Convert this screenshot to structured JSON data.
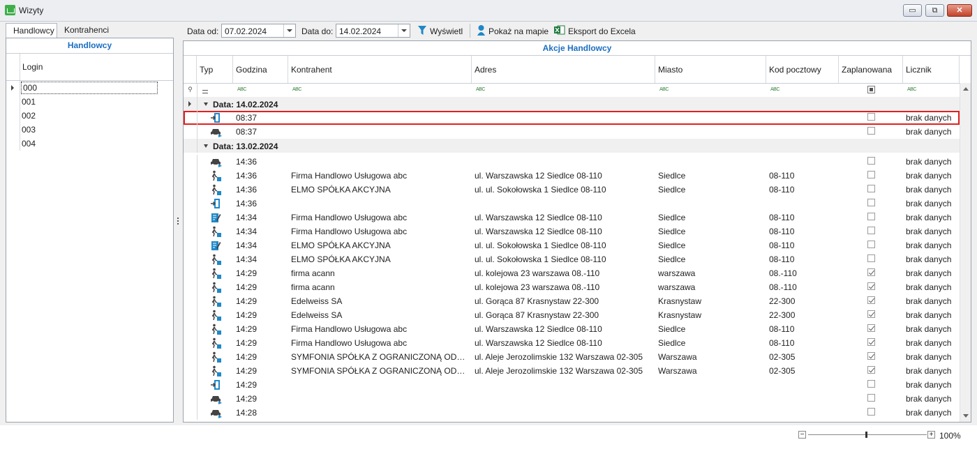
{
  "window": {
    "title": "Wizyty",
    "min_label": "▭",
    "restore_label": "⧉",
    "close_label": "✕"
  },
  "left_tabs": [
    {
      "label": "Handlowcy"
    },
    {
      "label": "Kontrahenci"
    }
  ],
  "left_panel": {
    "title": "Handlowcy",
    "column": "Login",
    "items": [
      "000",
      "001",
      "002",
      "003",
      "004"
    ],
    "selected_index": 0
  },
  "toolbar": {
    "date_from_label": "Data od:",
    "date_from": "07.02.2024",
    "date_to_label": "Data do:",
    "date_to": "14.02.2024",
    "show_label": "Wyświetl",
    "map_label": "Pokaż na mapie",
    "excel_label": "Eksport do Excela"
  },
  "grid": {
    "title": "Akcje Handlowcy",
    "columns": [
      "Typ",
      "Godzina",
      "Kontrahent",
      "Adres",
      "Miasto",
      "Kod pocztowy",
      "Zaplanowana",
      "Licznik"
    ],
    "groups": [
      {
        "label": "Data: 14.02.2024",
        "rows": [
          {
            "icon": "door-exit-icon",
            "time": "08:37",
            "client": "",
            "address": "",
            "city": "",
            "zip": "",
            "planned": false,
            "counter": "brak danych",
            "selected": true
          },
          {
            "icon": "car-icon",
            "time": "08:37",
            "client": "",
            "address": "",
            "city": "",
            "zip": "",
            "planned": false,
            "counter": "brak danych"
          }
        ]
      },
      {
        "label": "Data: 13.02.2024",
        "rows": [
          {
            "icon": "car-icon",
            "time": "14:36",
            "client": "",
            "address": "",
            "city": "",
            "zip": "",
            "planned": false,
            "counter": "brak danych"
          },
          {
            "icon": "walk-icon",
            "time": "14:36",
            "client": "Firma Handlowo Usługowa abc",
            "address": "ul. Warszawska 12 Siedlce 08-110",
            "city": "Siedlce",
            "zip": "08-110",
            "planned": false,
            "counter": "brak danych"
          },
          {
            "icon": "walk-icon",
            "time": "14:36",
            "client": "ELMO SPÓŁKA AKCYJNA",
            "address": "ul. ul. Sokołowska 1 Siedlce 08-110",
            "city": "Siedlce",
            "zip": "08-110",
            "planned": false,
            "counter": "brak danych"
          },
          {
            "icon": "door-exit-icon",
            "time": "14:36",
            "client": "",
            "address": "",
            "city": "",
            "zip": "",
            "planned": false,
            "counter": "brak danych"
          },
          {
            "icon": "note-edit-icon",
            "time": "14:34",
            "client": "Firma Handlowo Usługowa abc",
            "address": "ul. Warszawska 12 Siedlce 08-110",
            "city": "Siedlce",
            "zip": "08-110",
            "planned": false,
            "counter": "brak danych"
          },
          {
            "icon": "walk-icon",
            "time": "14:34",
            "client": "Firma Handlowo Usługowa abc",
            "address": "ul. Warszawska 12 Siedlce 08-110",
            "city": "Siedlce",
            "zip": "08-110",
            "planned": false,
            "counter": "brak danych"
          },
          {
            "icon": "note-edit-icon",
            "time": "14:34",
            "client": "ELMO SPÓŁKA AKCYJNA",
            "address": "ul. ul. Sokołowska 1 Siedlce 08-110",
            "city": "Siedlce",
            "zip": "08-110",
            "planned": false,
            "counter": "brak danych"
          },
          {
            "icon": "walk-icon",
            "time": "14:34",
            "client": "ELMO SPÓŁKA AKCYJNA",
            "address": "ul. ul. Sokołowska 1 Siedlce 08-110",
            "city": "Siedlce",
            "zip": "08-110",
            "planned": false,
            "counter": "brak danych"
          },
          {
            "icon": "walk-icon",
            "time": "14:29",
            "client": "firma acann",
            "address": "ul. kolejowa 23 warszawa 08.-110",
            "city": "warszawa",
            "zip": "08.-110",
            "planned": true,
            "counter": "brak danych"
          },
          {
            "icon": "walk-icon",
            "time": "14:29",
            "client": "firma acann",
            "address": "ul. kolejowa 23 warszawa 08.-110",
            "city": "warszawa",
            "zip": "08.-110",
            "planned": true,
            "counter": "brak danych"
          },
          {
            "icon": "walk-icon",
            "time": "14:29",
            "client": "Edelweiss SA",
            "address": "ul. Gorąca 87 Krasnystaw 22-300",
            "city": "Krasnystaw",
            "zip": "22-300",
            "planned": true,
            "counter": "brak danych"
          },
          {
            "icon": "walk-icon",
            "time": "14:29",
            "client": "Edelweiss SA",
            "address": "ul. Gorąca 87 Krasnystaw 22-300",
            "city": "Krasnystaw",
            "zip": "22-300",
            "planned": true,
            "counter": "brak danych"
          },
          {
            "icon": "walk-icon",
            "time": "14:29",
            "client": "Firma Handlowo Usługowa abc",
            "address": "ul. Warszawska 12 Siedlce 08-110",
            "city": "Siedlce",
            "zip": "08-110",
            "planned": true,
            "counter": "brak danych"
          },
          {
            "icon": "walk-icon",
            "time": "14:29",
            "client": "Firma Handlowo Usługowa abc",
            "address": "ul. Warszawska 12 Siedlce 08-110",
            "city": "Siedlce",
            "zip": "08-110",
            "planned": true,
            "counter": "brak danych"
          },
          {
            "icon": "walk-icon",
            "time": "14:29",
            "client": "SYMFONIA SPÓŁKA Z OGRANICZONĄ ODPOWIEDZIALNOŚCIĄ",
            "address": "ul. Aleje Jerozolimskie 132 Warszawa 02-305",
            "city": "Warszawa",
            "zip": "02-305",
            "planned": true,
            "counter": "brak danych"
          },
          {
            "icon": "walk-icon",
            "time": "14:29",
            "client": "SYMFONIA SPÓŁKA Z OGRANICZONĄ ODPOWIEDZIALNOŚCIĄ",
            "address": "ul. Aleje Jerozolimskie 132 Warszawa 02-305",
            "city": "Warszawa",
            "zip": "02-305",
            "planned": true,
            "counter": "brak danych"
          },
          {
            "icon": "door-exit-icon",
            "time": "14:29",
            "client": "",
            "address": "",
            "city": "",
            "zip": "",
            "planned": false,
            "counter": "brak danych"
          },
          {
            "icon": "car-icon",
            "time": "14:29",
            "client": "",
            "address": "",
            "city": "",
            "zip": "",
            "planned": false,
            "counter": "brak danych"
          },
          {
            "icon": "car-icon",
            "time": "14:28",
            "client": "",
            "address": "",
            "city": "",
            "zip": "",
            "planned": false,
            "counter": "brak danych"
          }
        ]
      }
    ]
  },
  "zoom": {
    "value_label": "100%",
    "minus": "−",
    "plus": "+",
    "level": 0.5
  },
  "colors": {
    "accent": "#1b6ec2",
    "selection_border": "#e02020",
    "icon_blue": "#1e88c8"
  }
}
